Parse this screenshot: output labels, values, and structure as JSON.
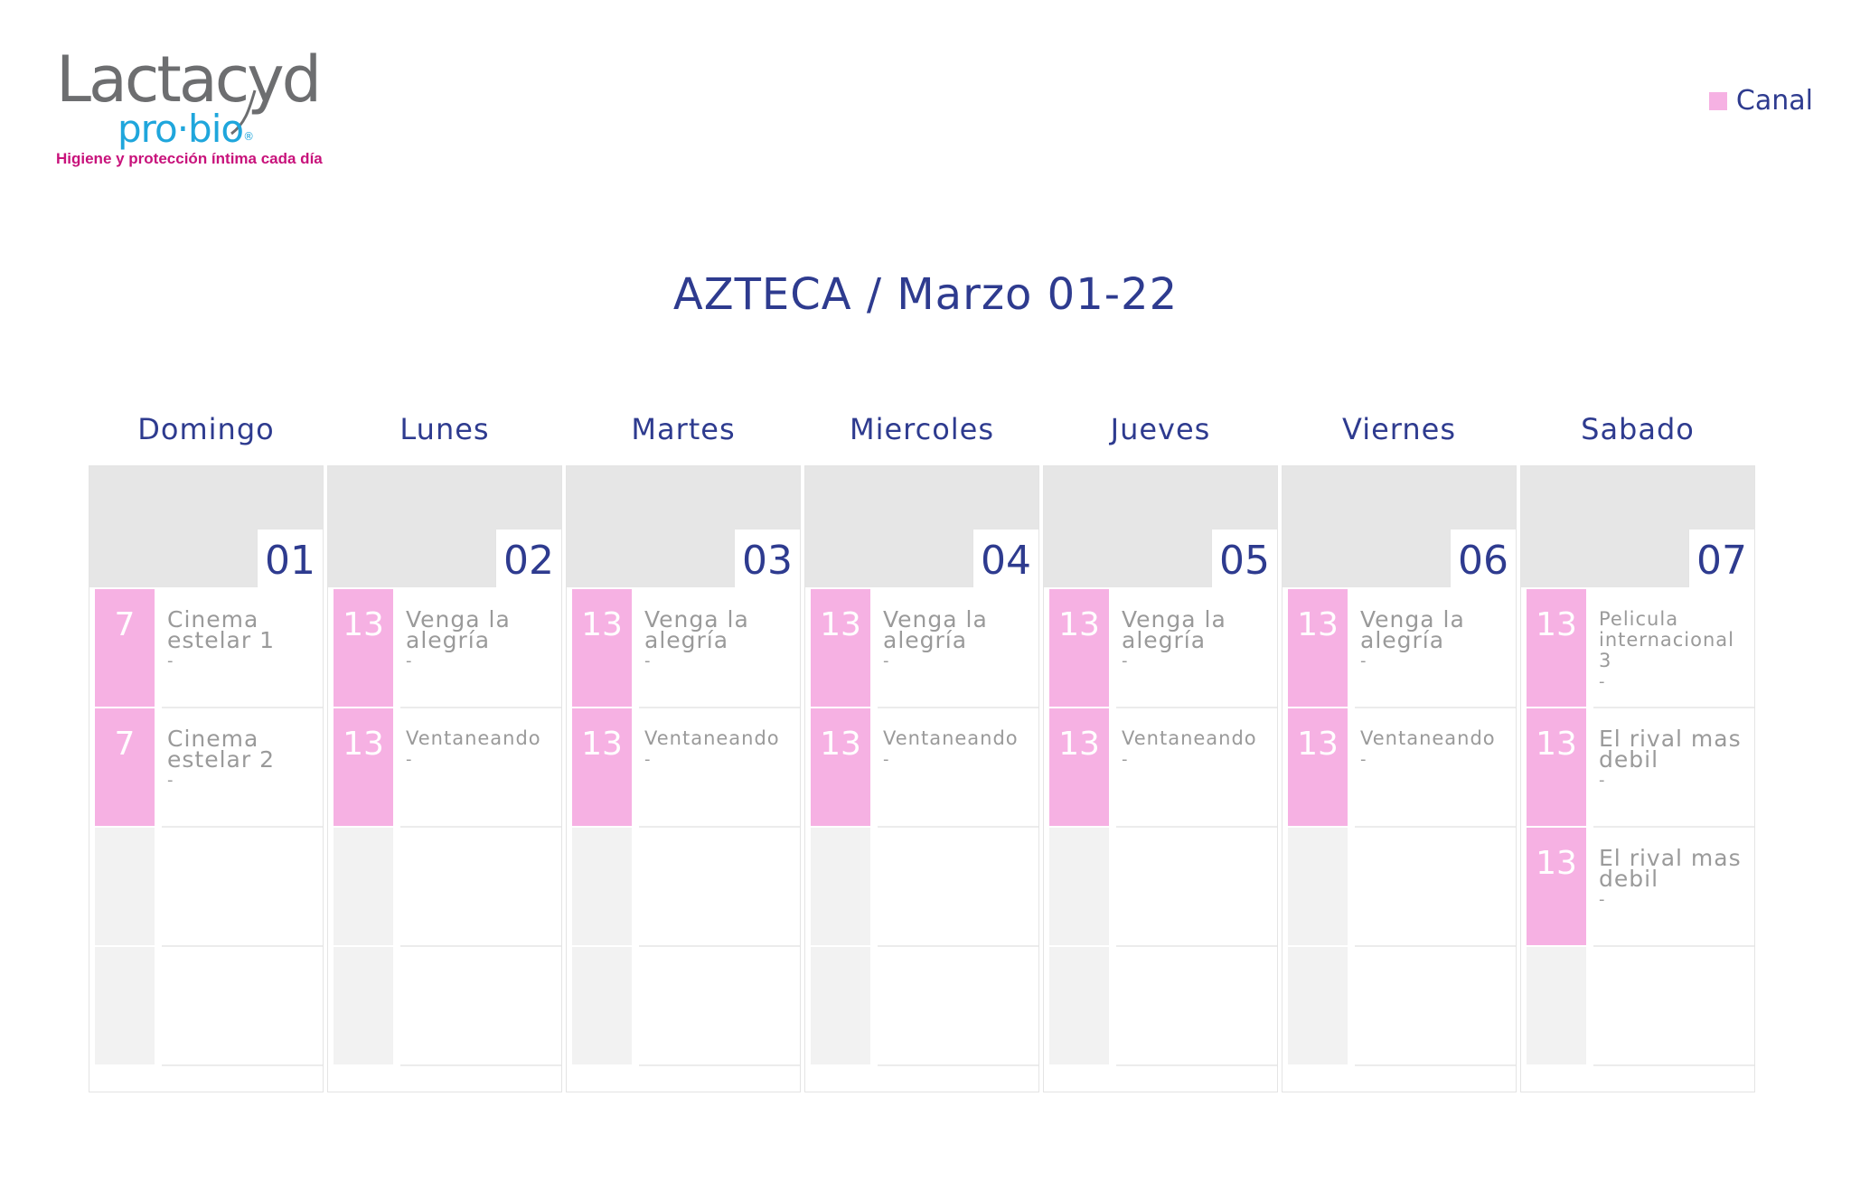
{
  "brand": {
    "name": "Lactacyd",
    "sub": "pro·bio",
    "tagline": "Higiene y protección íntima cada día",
    "accent_blue": "#1fa6dc",
    "accent_magenta": "#c8127b",
    "logo_gray": "#6d6e70"
  },
  "legend": {
    "label": "Canal",
    "color": "#f6b1e3"
  },
  "title": "AZTECA / Marzo 01-22",
  "colors": {
    "title": "#2e3b8f",
    "slot": "#f6b1e3",
    "header": "#e6e6e6",
    "text": "#9a9a9a"
  },
  "days": [
    {
      "name": "Domingo",
      "date": "01",
      "slots": [
        {
          "channel": "7",
          "program": "Cinema estelar 1",
          "sub": "-"
        },
        {
          "channel": "7",
          "program": "Cinema estelar 2",
          "sub": "-"
        }
      ]
    },
    {
      "name": "Lunes",
      "date": "02",
      "slots": [
        {
          "channel": "13",
          "program": "Venga la alegría",
          "sub": "-"
        },
        {
          "channel": "13",
          "program": "Ventaneando",
          "sub": "-"
        }
      ]
    },
    {
      "name": "Martes",
      "date": "03",
      "slots": [
        {
          "channel": "13",
          "program": "Venga la alegría",
          "sub": "-"
        },
        {
          "channel": "13",
          "program": "Ventaneando",
          "sub": "-"
        }
      ]
    },
    {
      "name": "Miercoles",
      "date": "04",
      "slots": [
        {
          "channel": "13",
          "program": "Venga la alegría",
          "sub": "-"
        },
        {
          "channel": "13",
          "program": "Ventaneando",
          "sub": "-"
        }
      ]
    },
    {
      "name": "Jueves",
      "date": "05",
      "slots": [
        {
          "channel": "13",
          "program": "Venga la alegría",
          "sub": "-"
        },
        {
          "channel": "13",
          "program": "Ventaneando",
          "sub": "-"
        }
      ]
    },
    {
      "name": "Viernes",
      "date": "06",
      "slots": [
        {
          "channel": "13",
          "program": "Venga la alegría",
          "sub": "-"
        },
        {
          "channel": "13",
          "program": "Ventaneando",
          "sub": "-"
        }
      ]
    },
    {
      "name": "Sabado",
      "date": "07",
      "slots": [
        {
          "channel": "13",
          "program": "Pelicula internacional 3",
          "sub": "-"
        },
        {
          "channel": "13",
          "program": "El rival mas debil",
          "sub": "-"
        },
        {
          "channel": "13",
          "program": "El rival mas debil",
          "sub": "-"
        }
      ]
    }
  ]
}
